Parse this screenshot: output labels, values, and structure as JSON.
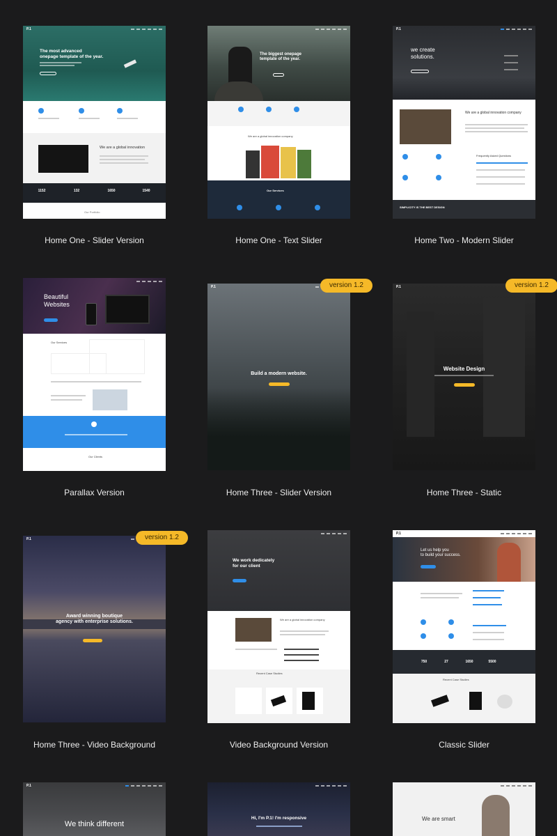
{
  "demos": [
    {
      "label": "Home One - Slider Version",
      "badge": "",
      "logo": "P.1",
      "headline": "The most advanced\nonepage template of the year.",
      "stats": [
        "1152",
        "132",
        "1650",
        "1540"
      ],
      "footer_text": "Our Portfolio"
    },
    {
      "label": "Home One - Text Slider",
      "badge": "",
      "headline": "The biggest onepage\ntemplate of the year.",
      "section": "We are a global innovation company",
      "services": "Our Services"
    },
    {
      "label": "Home Two - Modern Slider",
      "badge": "",
      "logo": "P.1",
      "headline": "we create\nsolutions.",
      "section": "We are a global innovation company",
      "faq": "Frequently Asked Questions",
      "footer_text": "SIMPLICITY IS THE BEST DESIGN"
    },
    {
      "label": "Parallax Version",
      "badge": "",
      "headline": "Beautiful\nWebsites",
      "section": "Our Services",
      "footer_text": "Our Clients"
    },
    {
      "label": "Home Three - Slider Version",
      "badge": "version 1.2",
      "logo": "P.1",
      "headline": "Build a modern website."
    },
    {
      "label": "Home Three - Static",
      "badge": "version 1.2",
      "logo": "P.1",
      "headline": "Website Design"
    },
    {
      "label": "Home Three - Video Background",
      "badge": "version 1.2",
      "logo": "P.1",
      "headline": "Award winning boutique\nagency with enterprise solutions."
    },
    {
      "label": "Video Background Version",
      "badge": "",
      "headline": "We work dedicately\nfor our client",
      "section": "We are a global innovation company",
      "footer_text": "Recent Case Studies"
    },
    {
      "label": "Classic Slider",
      "badge": "",
      "logo": "P.1",
      "headline": "Let us help you\nto build your success.",
      "stats": [
        "750",
        "27",
        "1650",
        "5500"
      ],
      "footer_text": "Recent Case Studies"
    },
    {
      "label": "",
      "badge": "",
      "logo": "P.1",
      "headline": "We think different"
    },
    {
      "label": "",
      "badge": "",
      "headline": "Hi, I'm P.1! I'm responsive"
    },
    {
      "label": "",
      "badge": "",
      "headline": "We are smart"
    }
  ],
  "colors": {
    "accent": "#2f8ee8",
    "badge": "#f5b928",
    "background": "#1b1b1c"
  }
}
